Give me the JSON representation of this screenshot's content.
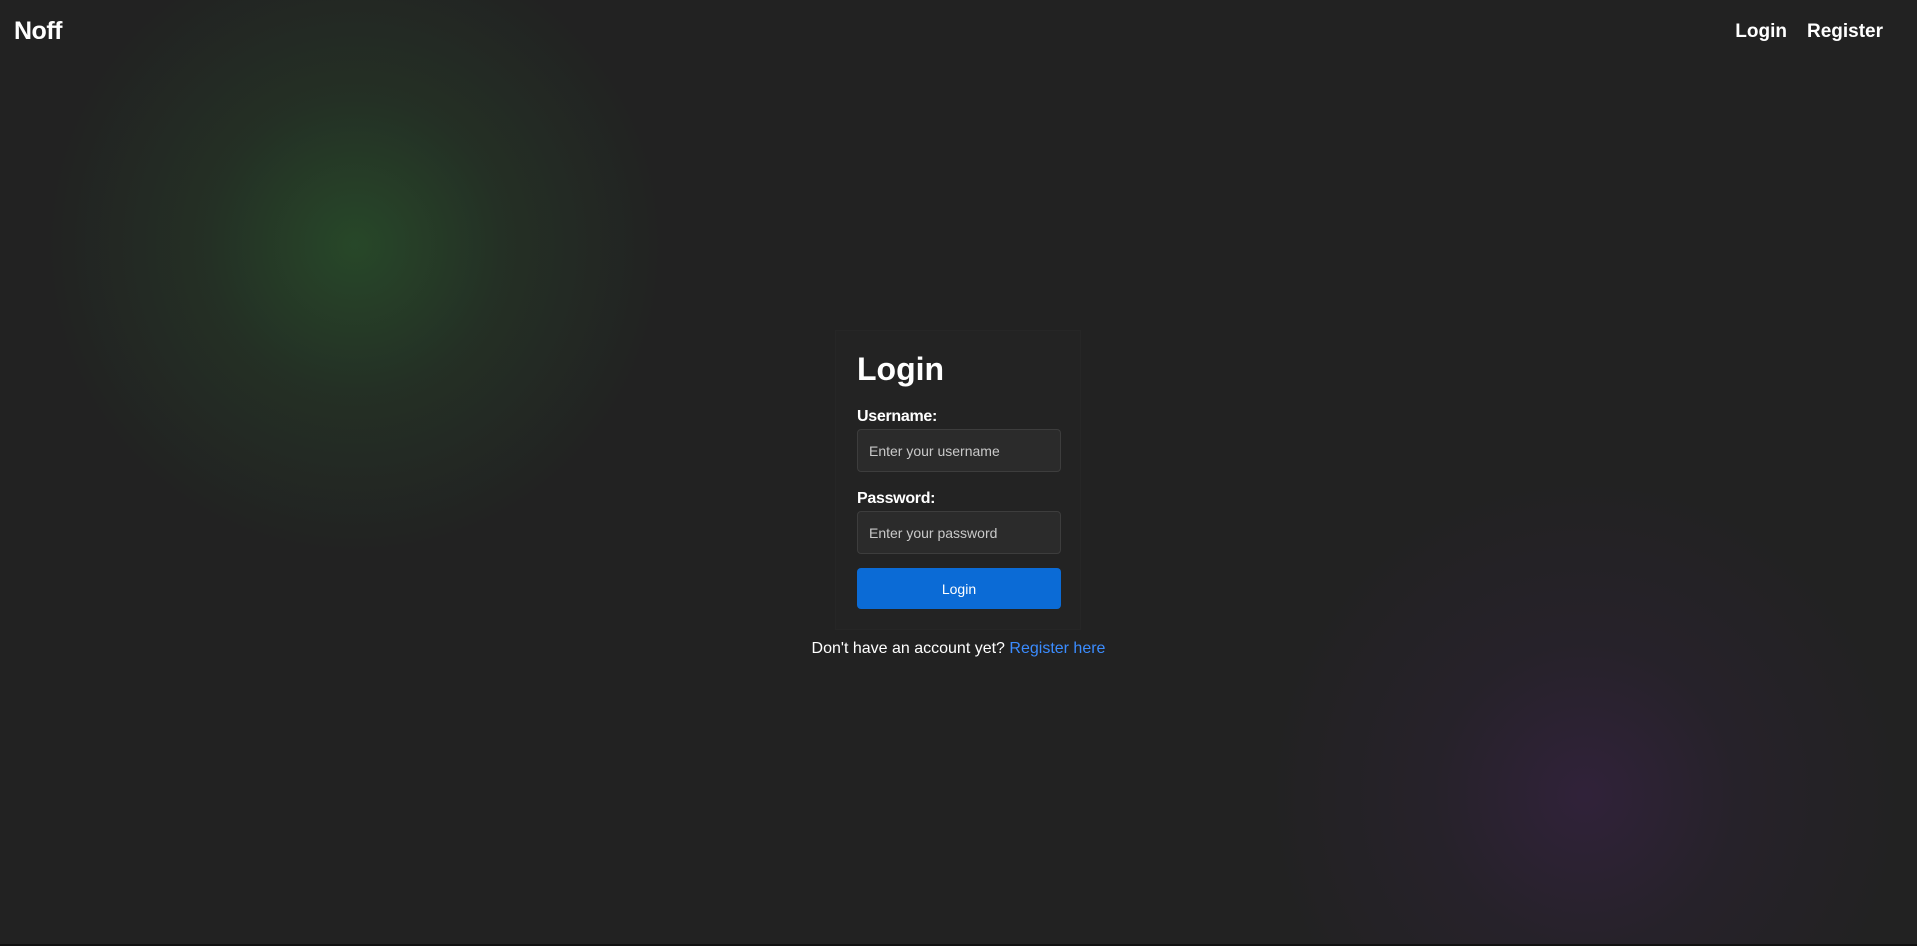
{
  "navbar": {
    "brand": "Noff",
    "links": [
      {
        "label": "Login"
      },
      {
        "label": "Register"
      }
    ]
  },
  "login_form": {
    "title": "Login",
    "username": {
      "label": "Username:",
      "placeholder": "Enter your username",
      "value": ""
    },
    "password": {
      "label": "Password:",
      "placeholder": "Enter your password",
      "value": ""
    },
    "submit_label": "Login"
  },
  "register_prompt": {
    "text": "Don't have an account yet?",
    "link_label": "Register here"
  },
  "colors": {
    "background": "#222222",
    "primary_button": "#0b6bd6",
    "link": "#3b8cff",
    "green_glow": "#284e2a",
    "purple_glow": "#32223c"
  }
}
